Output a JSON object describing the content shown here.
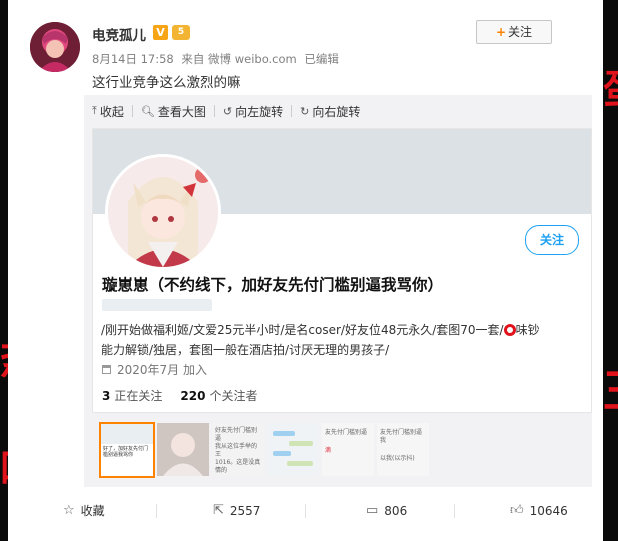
{
  "post": {
    "author": "电竞孤儿",
    "vip_badge": "V",
    "level_badge": "5",
    "follow_label": "关注",
    "follow_plus": "+",
    "date": "8月14日 17:58",
    "source": "来自 微博 weibo.com",
    "edited": "已编辑",
    "text": "这行业竞争这么激烈的嘛"
  },
  "toolbar": {
    "collapse_label": "收起",
    "view_large_label": "查看大图",
    "rotate_left_label": "向左旋转",
    "rotate_right_label": "向右旋转"
  },
  "profile": {
    "name": "璇崽崽（不约线下，加好友先付门槛别逼我骂你）",
    "follow_label": "关注",
    "bio_line1_before": "/刚开始做福利姬/文爱25元半小时/是名coser/好友位48元永久/套图70一套/",
    "bio_line1_after": "味钞",
    "bio_line2": "能力解锁/独居，套图一般在酒店拍/讨厌无理的男孩子/",
    "joined": "2020年7月 加入",
    "following_count": "3",
    "following_label": "正在关注",
    "followers_count": "220",
    "followers_label": "个关注者"
  },
  "thumbnails": {
    "thumb1_text": "好了，加好友先付门槛别逼我骂你",
    "thumb3_line1": "好友先付门槛别逼",
    "thumb3_line2": "我从这位手举的王",
    "thumb3_line3": "1016。这是没真情的",
    "thumb5_line1": "友先付门槛别逼",
    "thumb5_line2": "滴",
    "thumb6_line1": "友先付门槛别逼我",
    "thumb6_line2": "以我(以示抖)"
  },
  "actions": {
    "favorite_label": "收藏",
    "repost_count": "2557",
    "comment_count": "806",
    "like_count": "10646"
  },
  "colors": {
    "accent_orange": "#ff8200",
    "twitter_blue": "#1da1f2",
    "backdrop_red": "#e0121b"
  }
}
